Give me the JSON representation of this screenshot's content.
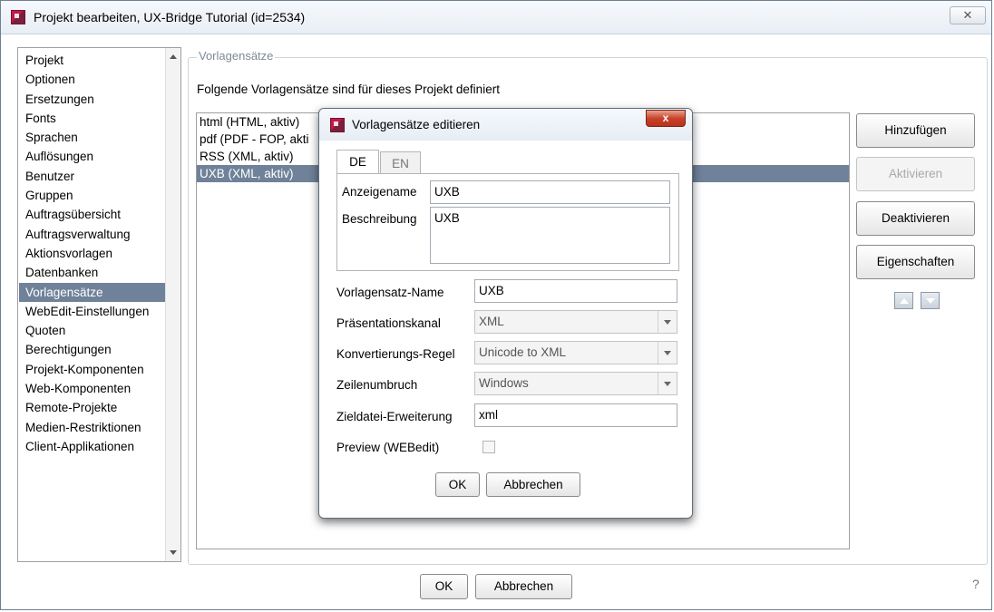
{
  "window": {
    "title": "Projekt bearbeiten, UX-Bridge Tutorial (id=2534)",
    "close_label": "✕"
  },
  "nav": {
    "items": [
      "Projekt",
      "Optionen",
      "Ersetzungen",
      "Fonts",
      "Sprachen",
      "Auflösungen",
      "Benutzer",
      "Gruppen",
      "Auftragsübersicht",
      "Auftragsverwaltung",
      "Aktionsvorlagen",
      "Datenbanken",
      "Vorlagensätze",
      "WebEdit-Einstellungen",
      "Quoten",
      "Berechtigungen",
      "Projekt-Komponenten",
      "Web-Komponenten",
      "Remote-Projekte",
      "Medien-Restriktionen",
      "Client-Applikationen"
    ],
    "selected": "Vorlagensätze"
  },
  "main": {
    "group_title": "Vorlagensätze",
    "intro": "Folgende Vorlagensätze sind für dieses Projekt definiert",
    "sets": [
      "html (HTML, aktiv)",
      "pdf (PDF - FOP, akti",
      "RSS (XML, aktiv)",
      "UXB (XML, aktiv)"
    ],
    "selected_set": "UXB (XML, aktiv)",
    "buttons": {
      "add": "Hinzufügen",
      "activate": "Aktivieren",
      "deactivate": "Deaktivieren",
      "properties": "Eigenschaften"
    }
  },
  "footer": {
    "ok": "OK",
    "cancel": "Abbrechen",
    "help": "?"
  },
  "dialog": {
    "title": "Vorlagensätze editieren",
    "close_label": "x",
    "tabs": [
      "DE",
      "EN"
    ],
    "active_tab": "DE",
    "display_name_label": "Anzeigename",
    "display_name_value": "UXB",
    "description_label": "Beschreibung",
    "description_value": "UXB",
    "template_name_label": "Vorlagensatz-Name",
    "template_name_value": "UXB",
    "channel_label": "Präsentationskanal",
    "channel_value": "XML",
    "conversion_label": "Konvertierungs-Regel",
    "conversion_value": "Unicode to XML",
    "linebreak_label": "Zeilenumbruch",
    "linebreak_value": "Windows",
    "extension_label": "Zieldatei-Erweiterung",
    "extension_value": "xml",
    "preview_label": "Preview (WEBedit)",
    "preview_checked": false,
    "ok": "OK",
    "cancel": "Abbrechen"
  },
  "colors": {
    "selection": "#6f8299",
    "brand_icon": "#c0194a",
    "dialog_close": "#c8432a"
  }
}
